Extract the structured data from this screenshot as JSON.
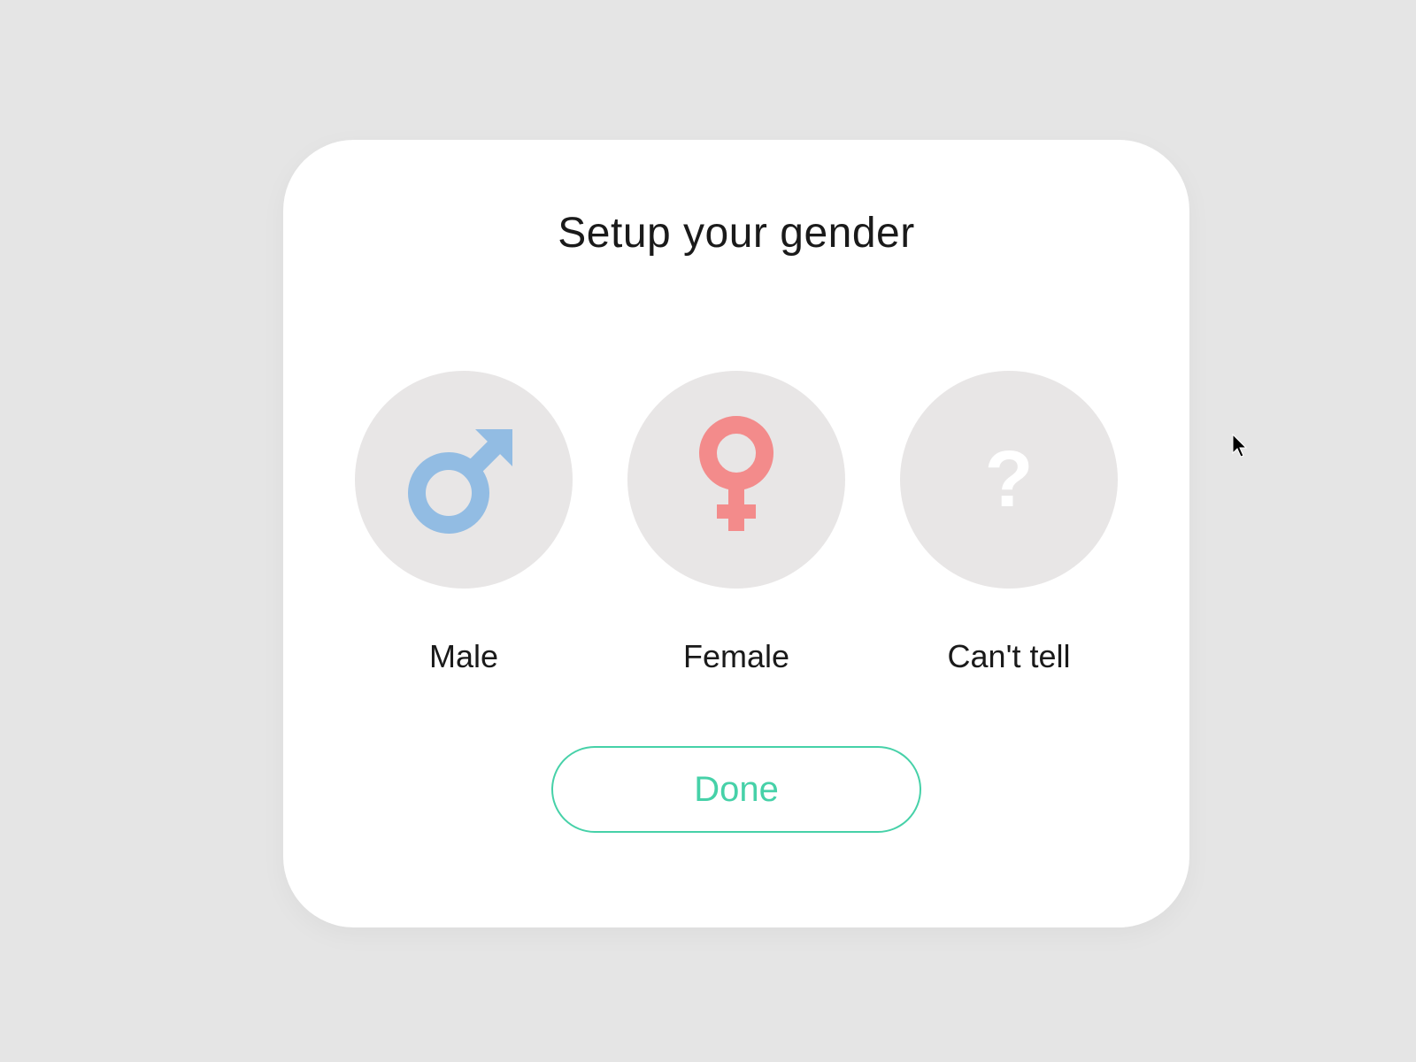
{
  "title": "Setup your gender",
  "options": [
    {
      "label": "Male",
      "icon": "male-icon",
      "color": "#92bce3"
    },
    {
      "label": "Female",
      "icon": "female-icon",
      "color": "#f38b8b"
    },
    {
      "label": "Can't tell",
      "icon": "question-icon",
      "color": "#ffffff"
    }
  ],
  "done_label": "Done",
  "colors": {
    "background": "#e5e5e5",
    "card": "#ffffff",
    "circle": "#e8e6e6",
    "accent": "#46d1a8",
    "male": "#92bce3",
    "female": "#f38b8b"
  }
}
